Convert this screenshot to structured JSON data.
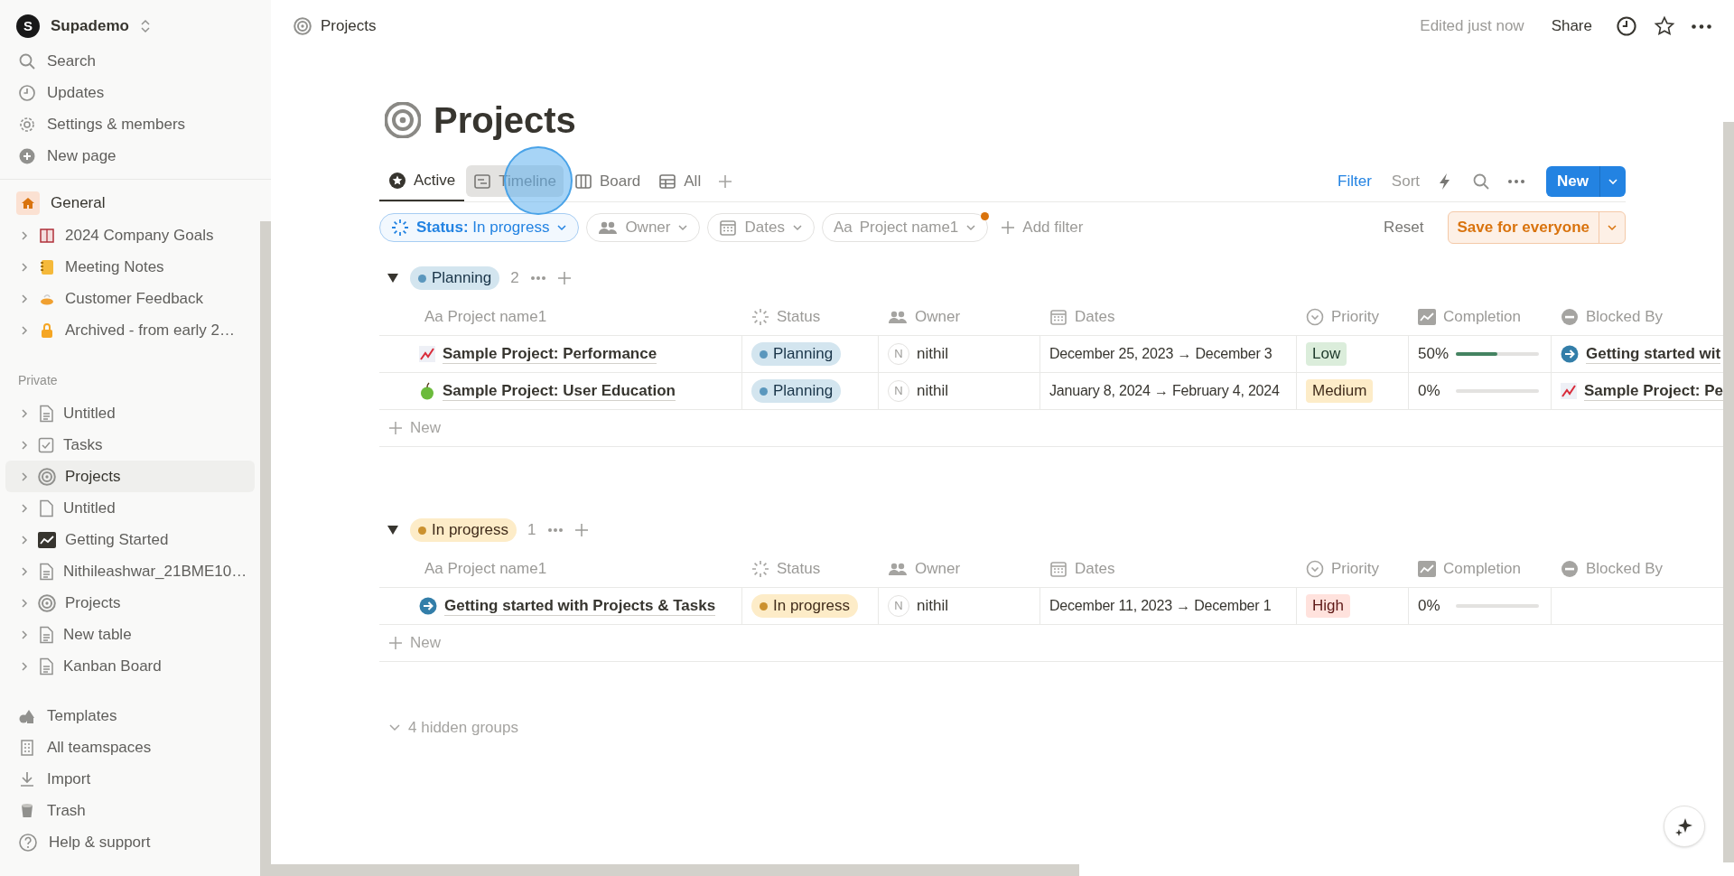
{
  "workspace": {
    "initial": "S",
    "name": "Supademo"
  },
  "sidebar": {
    "actions": [
      {
        "label": "Search"
      },
      {
        "label": "Updates"
      },
      {
        "label": "Settings & members"
      },
      {
        "label": "New page"
      }
    ],
    "teamspace": {
      "label": "General",
      "pages": [
        {
          "label": "2024 Company Goals"
        },
        {
          "label": "Meeting Notes"
        },
        {
          "label": "Customer Feedback"
        },
        {
          "label": "Archived - from early 2…"
        }
      ]
    },
    "private": {
      "heading": "Private",
      "pages": [
        {
          "label": "Untitled",
          "selected": false
        },
        {
          "label": "Tasks",
          "selected": false
        },
        {
          "label": "Projects",
          "selected": true
        },
        {
          "label": "Untitled",
          "selected": false
        },
        {
          "label": "Getting Started",
          "selected": false
        },
        {
          "label": "Nithileashwar_21BME10…",
          "selected": false
        },
        {
          "label": "Projects",
          "selected": false
        },
        {
          "label": "New table",
          "selected": false
        },
        {
          "label": "Kanban Board",
          "selected": false
        }
      ]
    },
    "footer": [
      {
        "label": "Templates"
      },
      {
        "label": "All teamspaces"
      },
      {
        "label": "Import"
      },
      {
        "label": "Trash"
      },
      {
        "label": "Help & support"
      }
    ]
  },
  "topbar": {
    "breadcrumb": "Projects",
    "edited": "Edited just now",
    "share": "Share"
  },
  "page": {
    "title": "Projects"
  },
  "views": [
    {
      "label": "Active",
      "selected": true,
      "hovered": false
    },
    {
      "label": "Timeline",
      "selected": false,
      "hovered": true
    },
    {
      "label": "Board",
      "selected": false,
      "hovered": false
    },
    {
      "label": "All",
      "selected": false,
      "hovered": false
    }
  ],
  "toolbar": {
    "filter": "Filter",
    "sort": "Sort",
    "new": "New"
  },
  "filters": [
    {
      "kind": "status",
      "label": "Status:",
      "value": "In progress",
      "modified": false
    },
    {
      "kind": "person",
      "label": "Owner",
      "modified": false
    },
    {
      "kind": "date",
      "label": "Dates",
      "modified": false
    },
    {
      "kind": "text",
      "prefix": "Aa",
      "label": "Project name1",
      "modified": true
    }
  ],
  "add_filter": "Add filter",
  "reset": "Reset",
  "save": "Save for everyone",
  "groups": [
    {
      "label": "Planning",
      "kind": "planning",
      "color": "#5b97bd",
      "count": "2",
      "expanded": true,
      "new_label": "New",
      "columns": [
        {
          "prefix": "Aa",
          "label": "Project name1"
        },
        {
          "label": "Status"
        },
        {
          "label": "Owner"
        },
        {
          "label": "Dates"
        },
        {
          "label": "Priority"
        },
        {
          "label": "Completion"
        },
        {
          "label": "Blocked By"
        }
      ],
      "rows": [
        {
          "name": "Sample Project: Performance",
          "status": {
            "label": "Planning",
            "kind": "planning",
            "color": "#5b97bd"
          },
          "owner_initial": "N",
          "owner": "nithil",
          "dates": "December 25, 2023 → December 3",
          "priority": {
            "label": "Low",
            "kind": "low"
          },
          "completion": {
            "reading": "50%",
            "level": 0.5
          },
          "blocked_by": "Getting started wit"
        },
        {
          "name": "Sample Project: User Education",
          "status": {
            "label": "Planning",
            "kind": "planning",
            "color": "#5b97bd"
          },
          "owner_initial": "N",
          "owner": "nithil",
          "dates": "January 8, 2024 → February 4, 2024",
          "priority": {
            "label": "Medium",
            "kind": "medium"
          },
          "completion": {
            "reading": "0%",
            "level": 0
          },
          "blocked_by": "Sample Project: Pe"
        }
      ]
    },
    {
      "label": "In progress",
      "kind": "in_progress",
      "color": "#cb912f",
      "count": "1",
      "expanded": true,
      "new_label": "New",
      "columns": [
        {
          "prefix": "Aa",
          "label": "Project name1"
        },
        {
          "label": "Status"
        },
        {
          "label": "Owner"
        },
        {
          "label": "Dates"
        },
        {
          "label": "Priority"
        },
        {
          "label": "Completion"
        },
        {
          "label": "Blocked By"
        }
      ],
      "rows": [
        {
          "name": "Getting started with Projects & Tasks",
          "status": {
            "label": "In progress",
            "kind": "in_progress",
            "color": "#cb912f"
          },
          "owner_initial": "N",
          "owner": "nithil",
          "dates": "December 11, 2023 → December 1",
          "priority": {
            "label": "High",
            "kind": "high"
          },
          "completion": {
            "reading": "0%",
            "level": 0
          }
        }
      ]
    }
  ],
  "hidden_groups": {
    "label": "4 hidden groups",
    "expanded": false
  }
}
